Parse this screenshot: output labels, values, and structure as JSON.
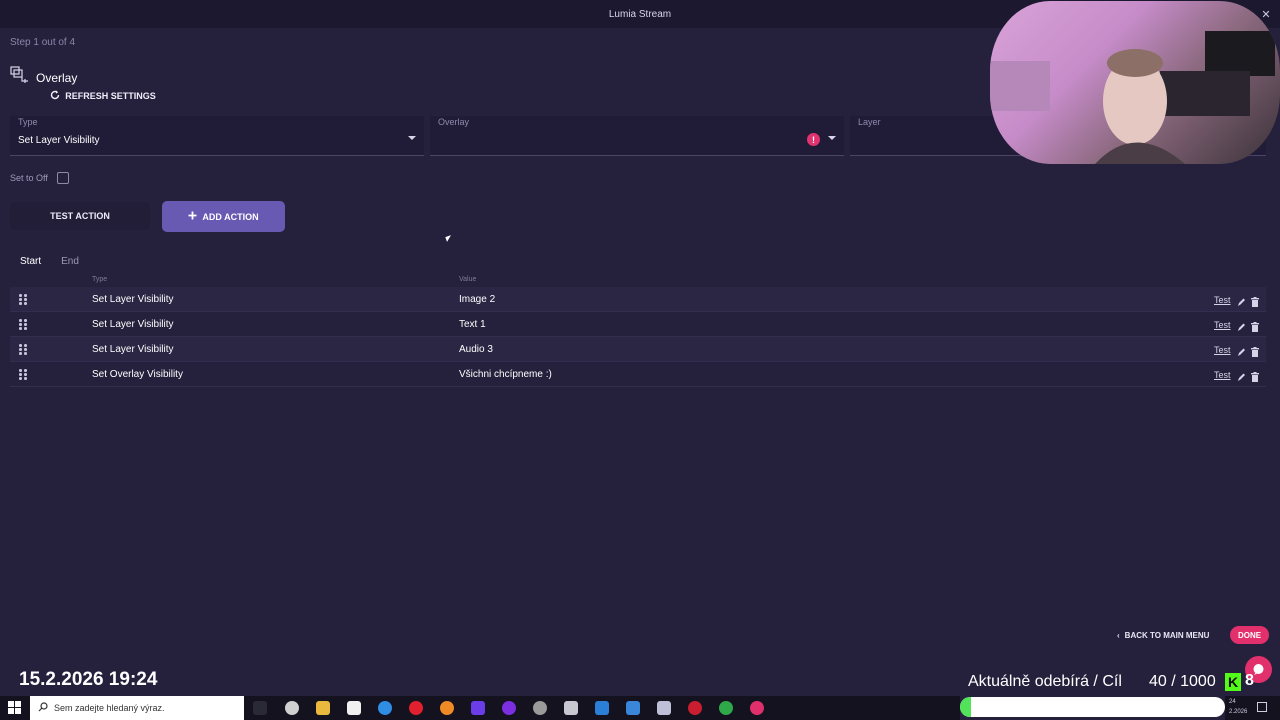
{
  "window": {
    "title": "Lumia Stream",
    "close_glyph": "✕"
  },
  "step": {
    "text": "Step 1 out of 4"
  },
  "section": {
    "title": "Overlay",
    "icon": "overlay-layers-icon"
  },
  "refresh": {
    "label": "REFRESH SETTINGS"
  },
  "fields": {
    "type": {
      "label": "Type",
      "value": "Set Layer Visibility"
    },
    "overlay": {
      "label": "Overlay",
      "value": "",
      "warning": "!"
    },
    "layer": {
      "label": "Layer",
      "value": ""
    }
  },
  "set_to_off": {
    "label": "Set to Off",
    "checked": false
  },
  "buttons": {
    "test_action": "TEST ACTION",
    "add_action": "ADD ACTION"
  },
  "tabs": [
    {
      "label": "Start",
      "active": true
    },
    {
      "label": "End",
      "active": false
    }
  ],
  "table": {
    "headers": {
      "type": "Type",
      "value": "Value"
    },
    "rows": [
      {
        "type": "Set Layer Visibility",
        "value": "Image 2",
        "test": "Test"
      },
      {
        "type": "Set Layer Visibility",
        "value": "Text 1",
        "test": "Test"
      },
      {
        "type": "Set Layer Visibility",
        "value": "Audio 3",
        "test": "Test"
      },
      {
        "type": "Set Overlay Visibility",
        "value": "Všichni chcípneme :)",
        "test": "Test"
      }
    ]
  },
  "footer": {
    "back": "BACK TO MAIN MENU",
    "done": "DONE"
  },
  "stream_overlay": {
    "datetime": "15.2.2026 19:24",
    "subscribers_label": "Aktuálně odebírá / Cíl",
    "count": "40 / 1000",
    "kick_count": "8",
    "kick_logo": "K",
    "progress_fraction": 0.04
  },
  "taskbar": {
    "search_placeholder": "Sem zadejte hledaný výraz.",
    "tray_time": "24",
    "tray_date": "2.2026"
  },
  "colors": {
    "accent": "#6859b3",
    "danger": "#e1306c",
    "background": "#25213d",
    "kick": "#53fc18"
  }
}
